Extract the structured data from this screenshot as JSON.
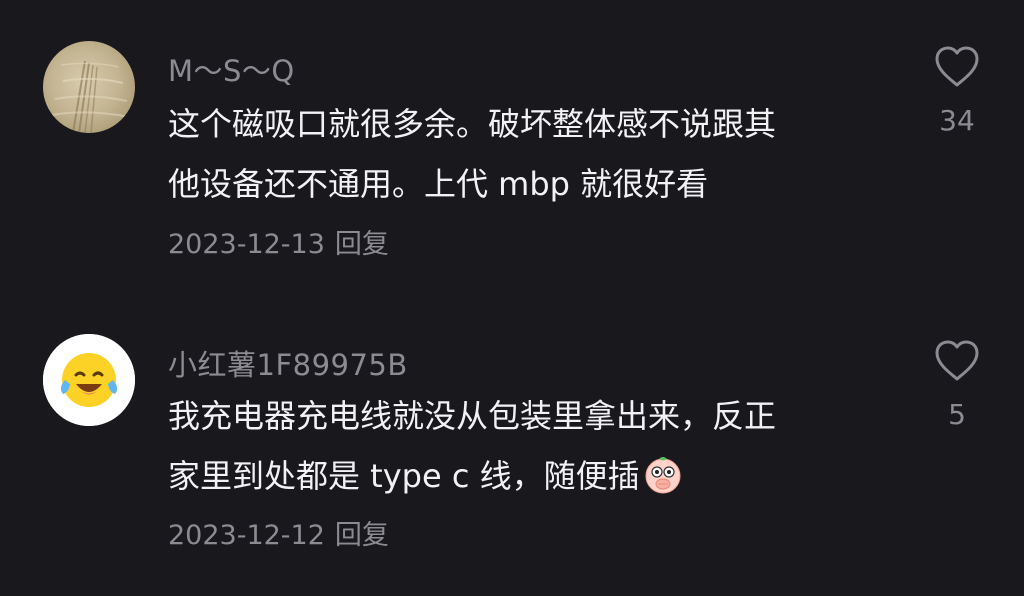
{
  "comments": [
    {
      "username": "M～S～Q",
      "avatar": "photo-avatar",
      "lines": [
        "这个磁吸口就很多余。破坏整体感不说跟其",
        "他设备还不通用。上代 mbp 就很好看"
      ],
      "date": "2023-12-13",
      "reply_label": "回复",
      "like_icon": "heart-outline-icon",
      "likes": "34"
    },
    {
      "username": "小红薯1F89975B",
      "avatar": "laughing-tears-emoji-avatar",
      "lines": [
        "我充电器充电线就没从包装里拿出来，反正",
        "家里到处都是 type c 线，随便插"
      ],
      "inline_emoji": "covering-mouth-emoji-icon",
      "date": "2023-12-12",
      "reply_label": "回复",
      "like_icon": "heart-outline-icon",
      "likes": "5"
    }
  ],
  "colors": {
    "background": "#19181d",
    "primary_text": "#f2f2f4",
    "secondary_text": "#8c8b92"
  }
}
